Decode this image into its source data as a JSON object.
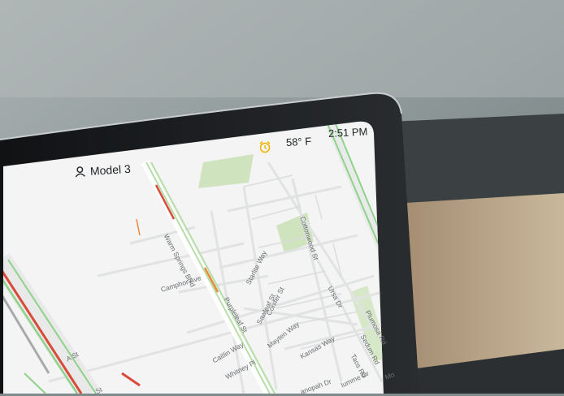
{
  "status_bar": {
    "temperature": "58° F",
    "time": "2:51 PM",
    "alarm_icon": "alarm-clock-icon",
    "alarm_color": "#f0b400"
  },
  "profile": {
    "icon": "user-icon",
    "name": "Model 3"
  },
  "map": {
    "streets": [
      {
        "id": "cottonwood-st",
        "label": "Cottonwood St"
      },
      {
        "id": "warm-springs-blvd",
        "label": "Warm Springs Blvd"
      },
      {
        "id": "starlite-way",
        "label": "Starlite Way"
      },
      {
        "id": "camphor-ave",
        "label": "Camphor Ave"
      },
      {
        "id": "purpleleaf-st",
        "label": "Purpleleaf St"
      },
      {
        "id": "conifer-st",
        "label": "Conifer St"
      },
      {
        "id": "sawleaf-st",
        "label": "Sawleaf St"
      },
      {
        "id": "ursa-dr",
        "label": "Ursa Dr"
      },
      {
        "id": "mayten-way",
        "label": "Mayten Way"
      },
      {
        "id": "plumosa-rd",
        "label": "Plumosa Rd"
      },
      {
        "id": "sedum-rd",
        "label": "Sedum Rd"
      },
      {
        "id": "kansas-way",
        "label": "Kansas Way"
      },
      {
        "id": "taos-rd",
        "label": "Taos Rd"
      },
      {
        "id": "caitlin-way",
        "label": "Caitlin Way"
      },
      {
        "id": "whitney-pl",
        "label": "Whitney Pl"
      },
      {
        "id": "a-st",
        "label": "A St"
      },
      {
        "id": "st-fragment",
        "label": "St"
      },
      {
        "id": "panopah-dr",
        "label": "anopah Dr"
      },
      {
        "id": "plumme-dr",
        "label": "lumme Dr"
      },
      {
        "id": "mo-fragment",
        "label": "Mo"
      }
    ]
  },
  "colors": {
    "traffic_green": "#8fd28a",
    "traffic_red": "#d94a3a",
    "traffic_orange": "#e88a3a",
    "park_green": "#cfe3bf",
    "map_background": "#f3f4f3"
  }
}
